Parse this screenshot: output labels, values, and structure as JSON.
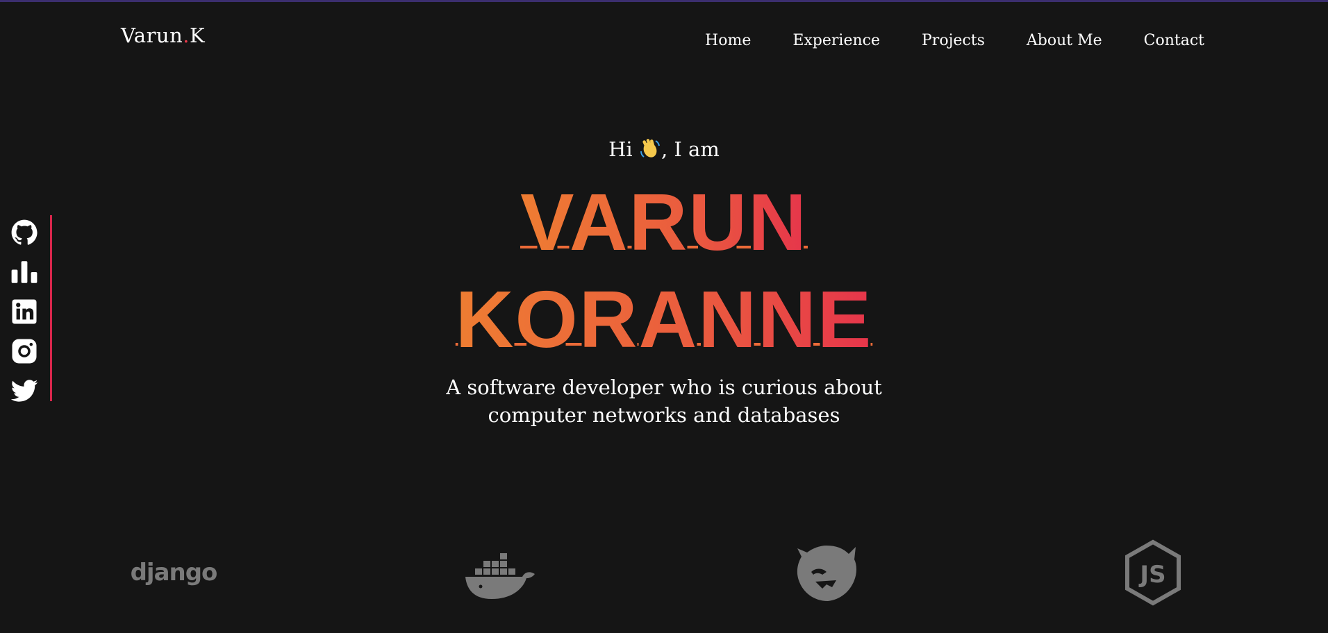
{
  "brand": {
    "first": "Varun",
    "dot": ".",
    "last": "K"
  },
  "nav": {
    "items": [
      {
        "label": "Home"
      },
      {
        "label": "Experience"
      },
      {
        "label": "Projects"
      },
      {
        "label": "About Me"
      },
      {
        "label": "Contact"
      }
    ]
  },
  "hero": {
    "greeting_before": "Hi ",
    "greeting_icon": "waving-hand-emoji",
    "greeting_after": ", I am",
    "name_line1": "VARUN",
    "name_line2": "KORANNE",
    "tagline_line1": "A software developer who is curious about",
    "tagline_line2": "computer networks and databases"
  },
  "social": {
    "icons": [
      "github-icon",
      "bar-chart-icon",
      "linkedin-icon",
      "instagram-icon",
      "twitter-icon"
    ]
  },
  "tech": {
    "logos": [
      "django-logo",
      "docker-logo",
      "nestjs-logo",
      "nodejs-logo"
    ],
    "django_text": "django"
  },
  "colors": {
    "background": "#151515",
    "gradient_start": "#ee7d32",
    "gradient_end": "#e6354b",
    "accent": "#d8264b",
    "logo_gray": "#7a7a7a"
  }
}
